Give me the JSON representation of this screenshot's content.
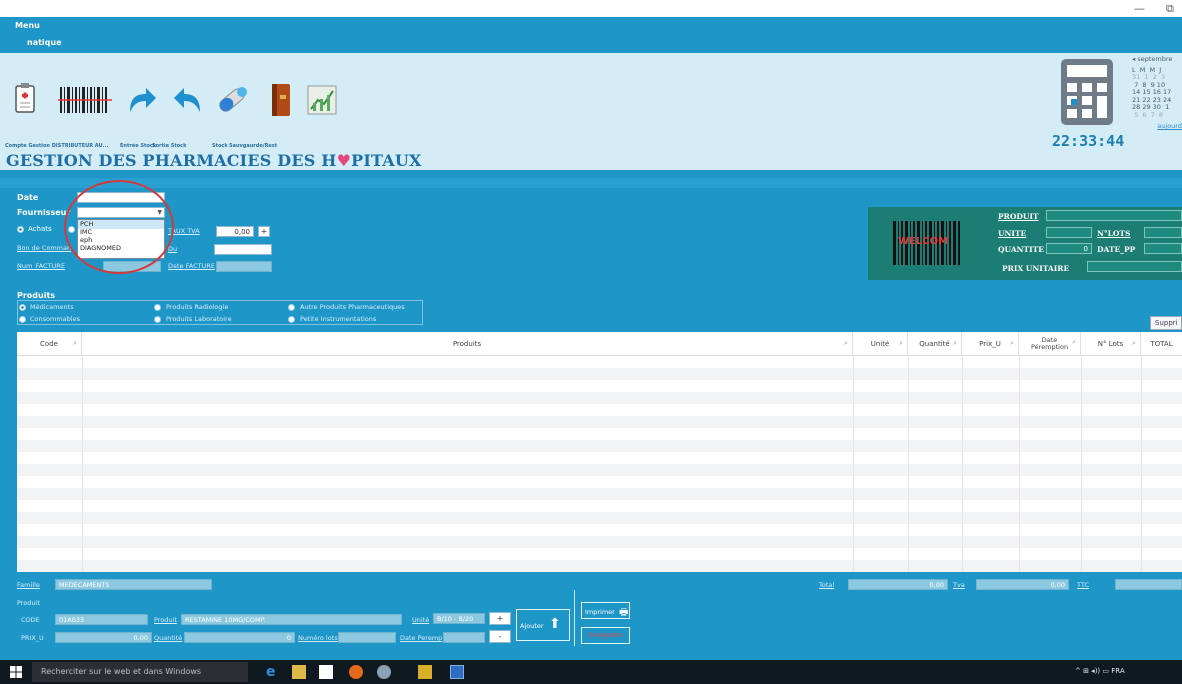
{
  "window": {
    "minimize": "—",
    "restore": "⧉"
  },
  "menu": {
    "menu_label": "Menu",
    "sub_label": "natique"
  },
  "toolbar": {
    "labels": [
      "Compte Gestion DISTRIBUTEUR AU...",
      "Entrée Stock",
      "Sortie Stock",
      "Stock",
      "Sauvgaurde/Rest"
    ],
    "icons": [
      "clipboard-icon",
      "barcode-icon",
      "redo-arrow-icon",
      "undo-arrow-icon",
      "pill-icon",
      "book-icon",
      "chart-icon"
    ]
  },
  "app_title": {
    "before": "GESTION DES PHARMACIES DES H",
    "after": "PITAUX"
  },
  "clock": "22:33:44",
  "calendar": {
    "month": "septembre",
    "days_header": "L  M  M  J",
    "rows": [
      "31  1  2  3",
      " 7  8  9 10",
      "14 15 16 17",
      "21 22 23 24",
      "28 29 30  1",
      " 5  6  7  8"
    ],
    "today_link": "aujourd"
  },
  "form": {
    "date_label": "Date",
    "fournisseur_label": "Fournisseur",
    "achats_label": "Achats",
    "bon_label": "Bon de Comman",
    "num_facture_label": "Num_FACTURE",
    "taux_tva_label": "TAUX TVA",
    "taux_tva_value": "0,00",
    "plus": "+",
    "du_label": "Du",
    "date_facture_label": "Date FACTURE",
    "dropdown_options": [
      "PCH",
      "IMC",
      "eph",
      "DIAGNOMED"
    ]
  },
  "welcome": {
    "logo_text": "WELCOM",
    "produit_label": "PRODUIT",
    "unite_label": "UNITE",
    "nlots_label": "N°LOTS",
    "quantite_label": "QUANTITE",
    "quantite_value": "0",
    "date_pp_label": "DATE_PP",
    "prix_label": "PRIX UNITAIRE"
  },
  "produits": {
    "title": "Produits",
    "options": [
      "Médicaments",
      "Produits Radiologie",
      "Autre Produits Pharmaceutiques",
      "Consommables",
      "Produits Laboratoire",
      "Petite Instrumentations"
    ]
  },
  "grid": {
    "delete_label": "Suppri",
    "columns": [
      "Code",
      "Produits",
      "Unité",
      "Quantité",
      "Prix_U",
      "Date Péremption",
      "N° Lots",
      "TOTAL"
    ]
  },
  "bottom": {
    "famille_label": "Famille",
    "famille_value": "MEDECAMENTS",
    "produit_section": "Produit",
    "code_label": "CODE",
    "code_value": "01A033",
    "produit_label": "Produit",
    "produit_value": "RESTAMINE 10MG/COMP.",
    "unite_label": "Unité",
    "unite_value": "B/10 - B/20",
    "prix_label": "PRIX_U",
    "prix_value": "0,00",
    "quantite_label": "Quantité",
    "quantite_value": "0",
    "numero_lots_label": "Numéro lots",
    "date_peremp_label": "Date Peremp",
    "plus": "+",
    "minus": "-",
    "ajouter_label": "Ajouter",
    "imprimer_label": "Imprimer",
    "enregistrer_label": "Enregistrer",
    "total_label": "Total",
    "total_value": "0,00",
    "tva_label": "Tva",
    "tva_value": "0,00",
    "ttc_label": "TTC"
  },
  "taskbar": {
    "search_placeholder": "Recherciter sur le web et dans Windows",
    "tray": "^  ⊞  ◂))  ▭  FRA"
  },
  "colors": {
    "panel": "#1f96c8",
    "title": "#1d6fa6",
    "welcome": "#1b7d73",
    "annotation": "#d23a3a"
  }
}
